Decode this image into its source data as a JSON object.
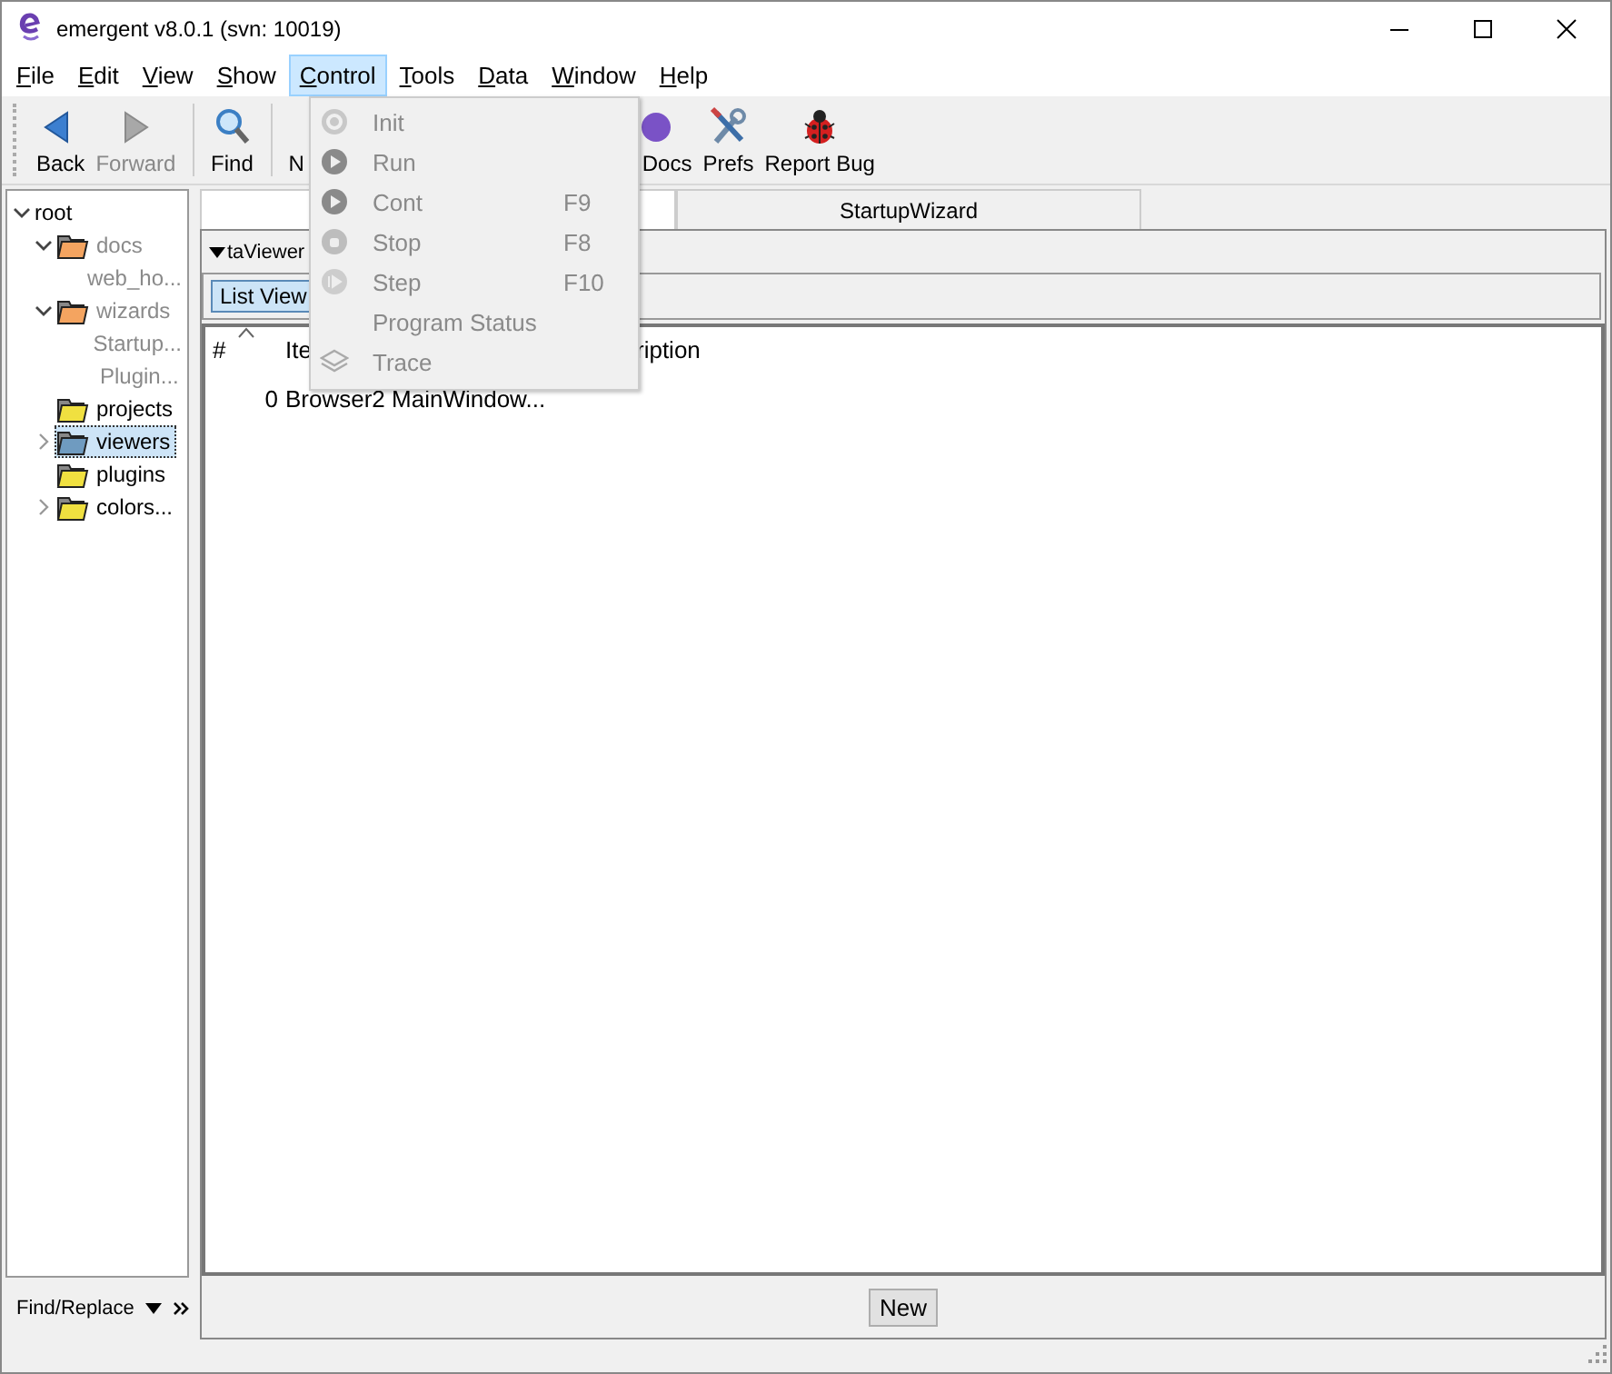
{
  "window": {
    "title": "emergent v8.0.1 (svn: 10019)"
  },
  "menu_bar": [
    {
      "label": "File",
      "selected": false
    },
    {
      "label": "Edit",
      "selected": false
    },
    {
      "label": "View",
      "selected": false
    },
    {
      "label": "Show",
      "selected": false
    },
    {
      "label": "Control",
      "selected": true
    },
    {
      "label": "Tools",
      "selected": false
    },
    {
      "label": "Data",
      "selected": false
    },
    {
      "label": "Window",
      "selected": false
    },
    {
      "label": "Help",
      "selected": false
    }
  ],
  "toolbar": [
    {
      "label": "Back",
      "kind": "back",
      "disabled": false
    },
    {
      "label": "Forward",
      "kind": "forward",
      "disabled": true
    },
    {
      "kind": "separator"
    },
    {
      "label": "Find",
      "kind": "find",
      "disabled": false
    },
    {
      "kind": "separator"
    },
    {
      "label": "N",
      "kind": "plain",
      "disabled": false
    },
    {
      "kind": "hidden"
    },
    {
      "label": "Docs",
      "kind": "docs",
      "disabled": false
    },
    {
      "label": "Prefs",
      "kind": "prefs",
      "disabled": false
    },
    {
      "label": "Report Bug",
      "kind": "bug",
      "disabled": false
    }
  ],
  "tree": [
    {
      "label": "root",
      "kind": "root",
      "expanded": true,
      "selected": false,
      "disabled": false,
      "children": [
        {
          "label": "docs",
          "kind": "branch",
          "expanded": true,
          "selected": false,
          "disabled": true,
          "children": [
            {
              "label": "web_ho...",
              "kind": "item",
              "selected": false,
              "disabled": true
            }
          ]
        },
        {
          "label": "wizards",
          "kind": "branch",
          "expanded": true,
          "selected": false,
          "disabled": true,
          "children": [
            {
              "label": "Startup...",
              "kind": "item",
              "selected": false,
              "disabled": true
            },
            {
              "label": "Plugin...",
              "kind": "item",
              "selected": false,
              "disabled": true
            }
          ]
        },
        {
          "label": "projects",
          "kind": "folder",
          "expanded": false,
          "selected": false,
          "disabled": false
        },
        {
          "label": "viewers",
          "kind": "branch",
          "expanded": false,
          "selected": true,
          "disabled": false
        },
        {
          "label": "plugins",
          "kind": "folder",
          "expanded": false,
          "selected": false,
          "disabled": false
        },
        {
          "label": "colors...",
          "kind": "branch",
          "expanded": false,
          "selected": false,
          "disabled": false
        }
      ]
    }
  ],
  "find_replace": {
    "label": "Find/Replace"
  },
  "tabs": [
    {
      "selected": true
    },
    {
      "label": "StartupWizard",
      "selected": false
    }
  ],
  "panel": {
    "title": "taViewer",
    "view_button": "List View",
    "table": {
      "columns": [
        "#",
        "Ite",
        "ription"
      ],
      "rows": [
        [
          "0",
          "Browser2 MainWindow..."
        ]
      ]
    },
    "new_button": "New"
  },
  "control_menu": [
    {
      "label": "Init",
      "kind": "init",
      "disabled": true
    },
    {
      "label": "Run",
      "kind": "run",
      "disabled": true
    },
    {
      "label": "Cont",
      "kind": "run",
      "shortcut": "F9",
      "disabled": true
    },
    {
      "label": "Stop",
      "kind": "stop",
      "shortcut": "F8",
      "disabled": true
    },
    {
      "label": "Step",
      "kind": "step",
      "shortcut": "F10",
      "disabled": true
    },
    {
      "label": "Program Status",
      "kind": "none",
      "disabled": true
    },
    {
      "label": "Trace",
      "kind": "layers",
      "disabled": true
    }
  ]
}
